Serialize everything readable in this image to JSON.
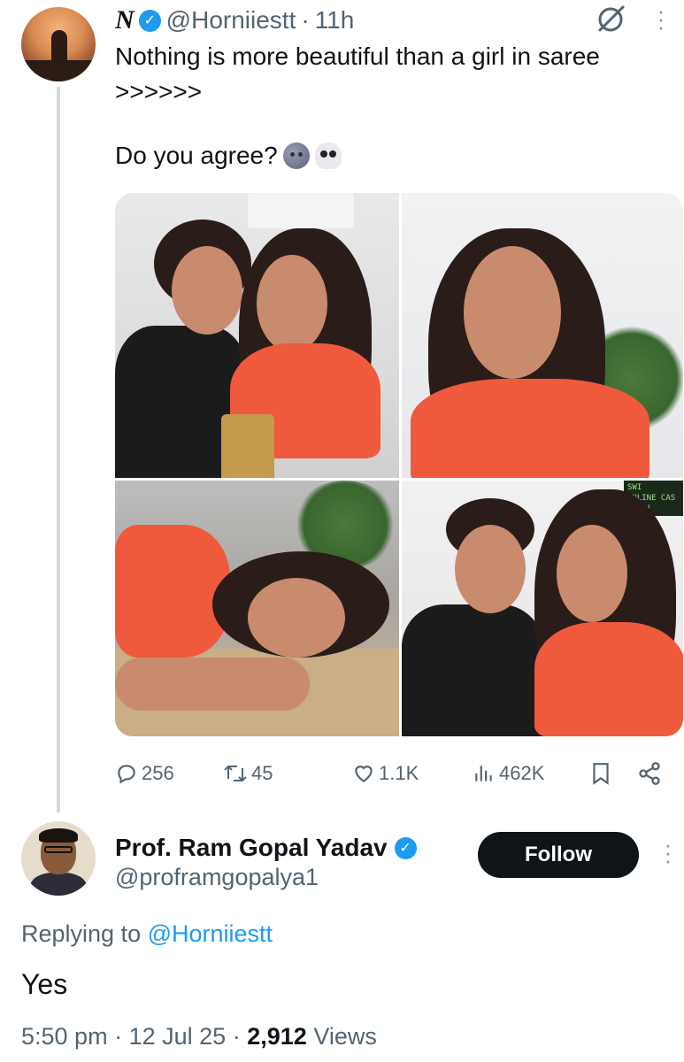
{
  "tweet": {
    "author_name": "N",
    "handle": "@Horniiestt",
    "separator": "·",
    "time": "11h",
    "text_line1": "Nothing is more beautiful than a girl in saree",
    "text_line2": ">>>>>>",
    "text_line3": "Do you agree?",
    "emojis": [
      "new-moon-face",
      "skull"
    ],
    "stats": {
      "replies": "256",
      "reposts": "45",
      "likes": "1.1K",
      "views": "462K"
    },
    "photo_sign_text": "SWI\nONLINE CAS\nPLAY!"
  },
  "reply": {
    "author_name": "Prof. Ram Gopal Yadav",
    "handle": "@proframgopalya1",
    "follow_label": "Follow",
    "replying_prefix": "Replying to",
    "replying_to": "@Horniiestt",
    "text": "Yes",
    "time": "5:50 pm",
    "date": "12 Jul 25",
    "views_count": "2,912",
    "views_label": "Views",
    "meta_separator": "·"
  },
  "colors": {
    "accent": "#1d9bf0",
    "secondary_text": "#536471",
    "follow_button": "#0f1419"
  }
}
